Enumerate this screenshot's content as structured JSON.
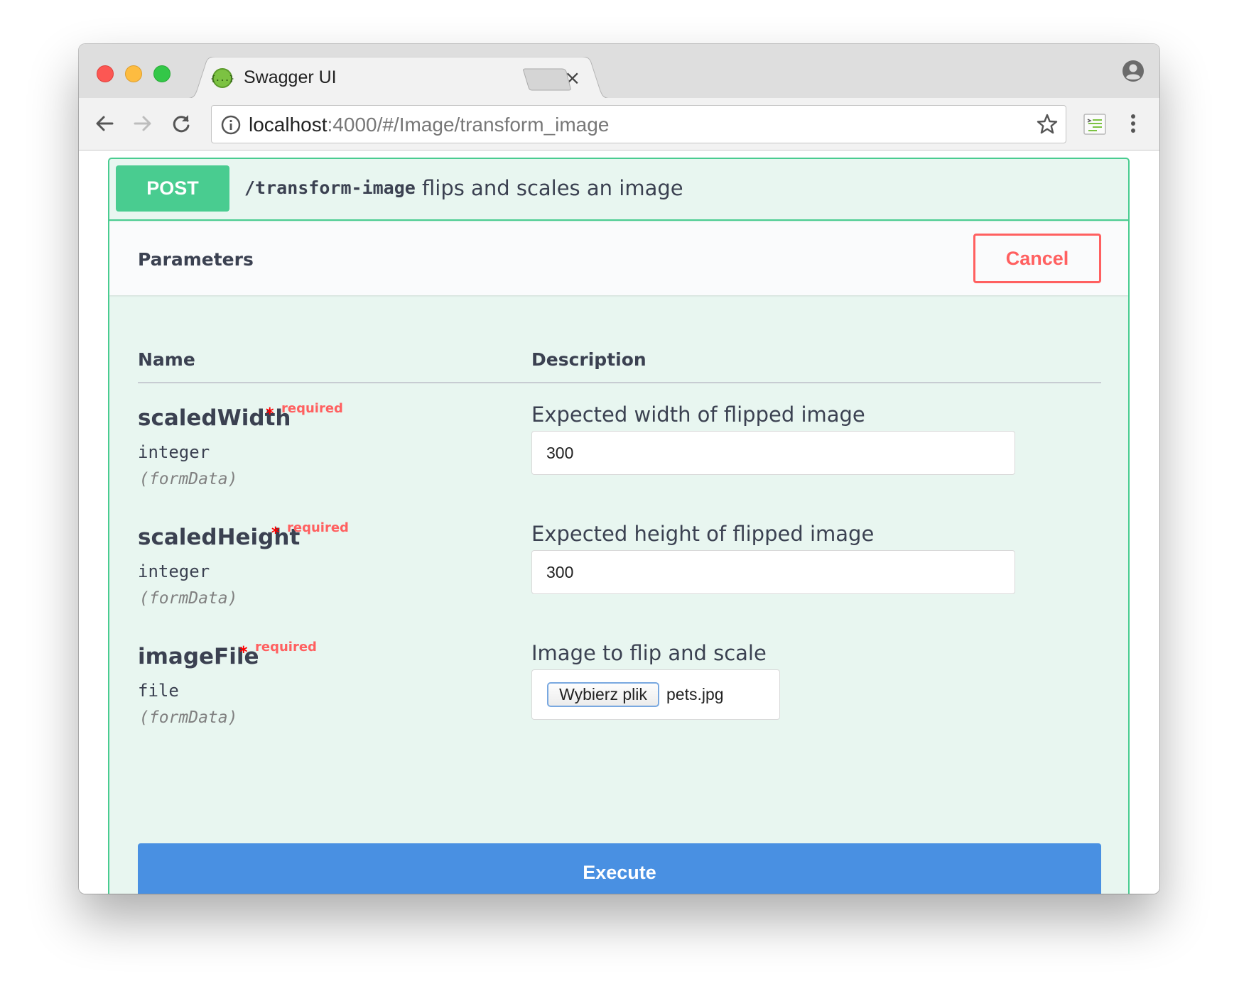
{
  "browser": {
    "tab_title": "Swagger UI",
    "tab_favicon_text": "{...}",
    "tab_close": "×",
    "url_host": "localhost",
    "url_rest": ":4000/#/Image/transform_image"
  },
  "operation": {
    "method": "POST",
    "path": "/transform-image",
    "summary": "flips and scales an image"
  },
  "parameters": {
    "title": "Parameters",
    "cancel_label": "Cancel",
    "col_name": "Name",
    "col_description": "Description",
    "items": [
      {
        "name": "scaledWidth",
        "star": "*",
        "required_label": "required",
        "type": "integer",
        "in": "(formData)",
        "description": "Expected width of flipped image",
        "value": "300"
      },
      {
        "name": "scaledHeight",
        "star": "*",
        "required_label": "required",
        "type": "integer",
        "in": "(formData)",
        "description": "Expected height of flipped image",
        "value": "300"
      },
      {
        "name": "imageFile",
        "star": "*",
        "required_label": "required",
        "type": "file",
        "in": "(formData)",
        "description": "Image to flip and scale",
        "file_button_label": "Wybierz plik",
        "file_name": "pets.jpg"
      }
    ]
  },
  "execute_label": "Execute",
  "colors": {
    "post_green": "#49cc90",
    "cancel_red": "#ff6060",
    "execute_blue": "#4990e2",
    "required_red": "#ff0000"
  }
}
